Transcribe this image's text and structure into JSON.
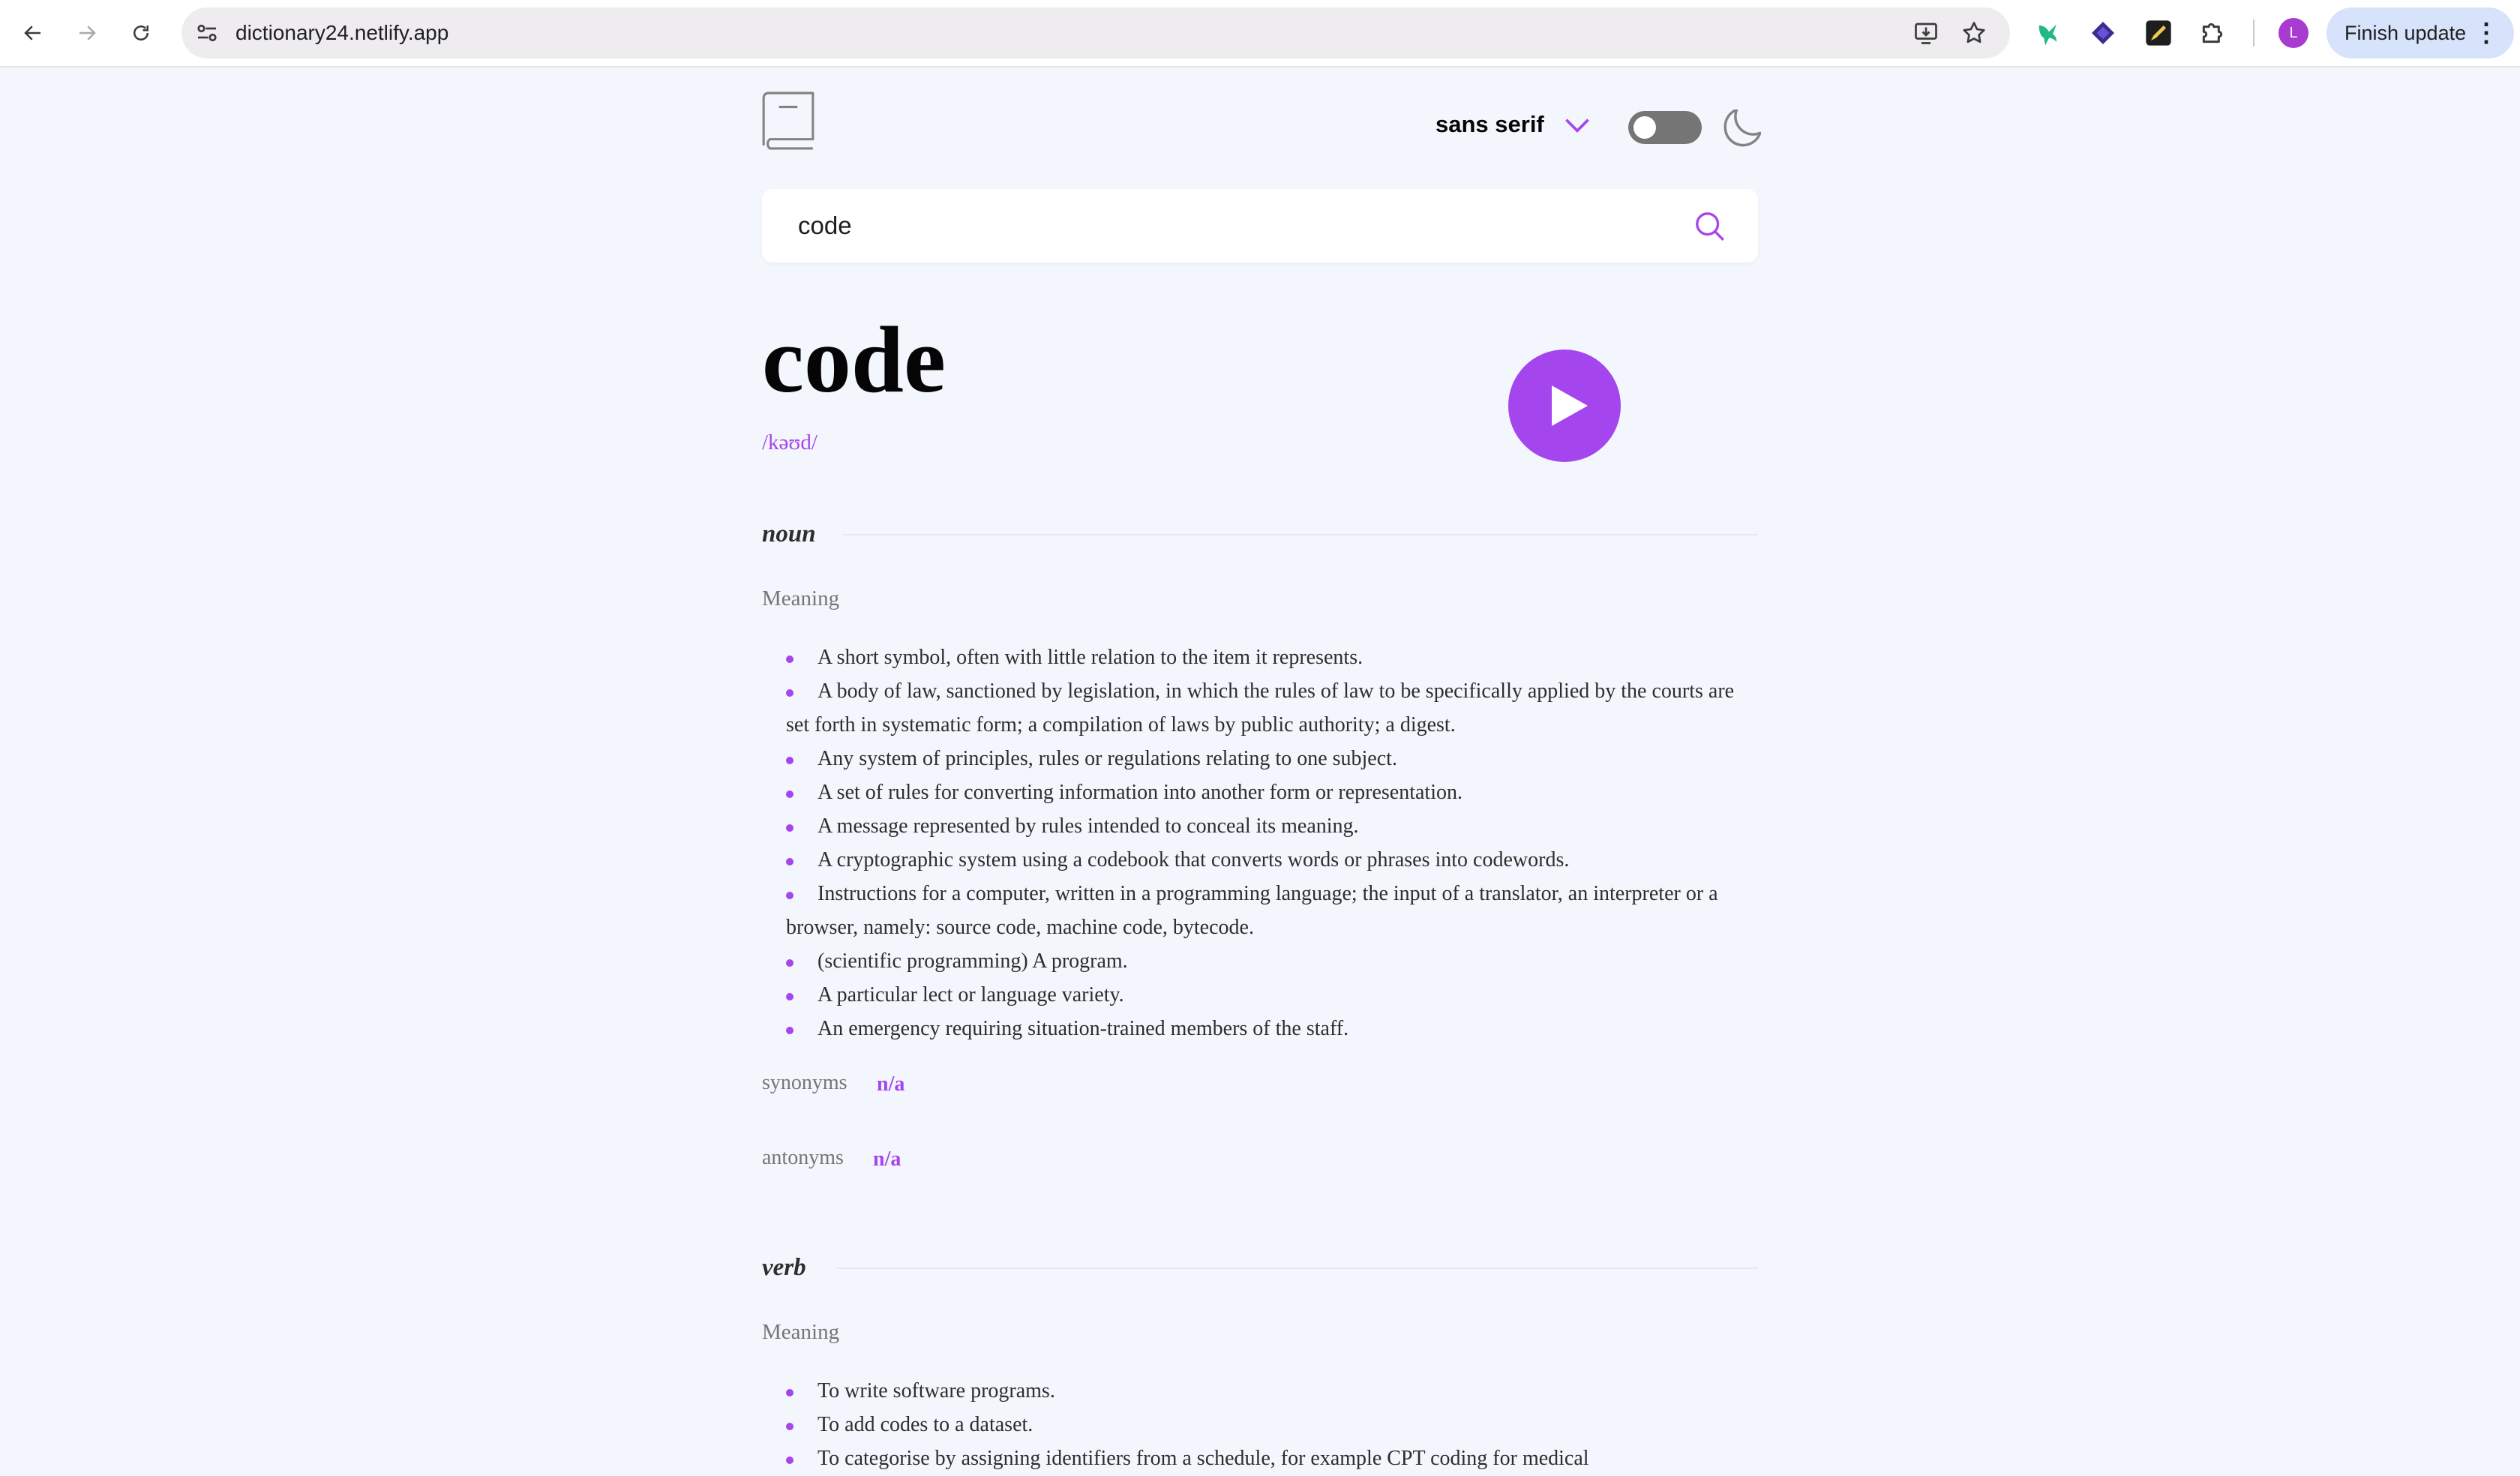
{
  "browser": {
    "url": "dictionary24.netlify.app",
    "profile_initial": "L",
    "update_label": "Finish update",
    "menu_dots": "⋮"
  },
  "app": {
    "font_label": "sans serif",
    "accent": "#a445ed",
    "search": {
      "value": "code"
    },
    "word": "code",
    "phonetic": "/kəʊd/",
    "meanings": [
      {
        "part_of_speech": "noun",
        "label": "Meaning",
        "definitions": [
          "A short symbol, often with little relation to the item it represents.",
          "A body of law, sanctioned by legislation, in which the rules of law to be specifically applied by the courts are set forth in systematic form; a compilation of laws by public authority; a digest.",
          "Any system of principles, rules or regulations relating to one subject.",
          "A set of rules for converting information into another form or representation.",
          "A message represented by rules intended to conceal its meaning.",
          "A cryptographic system using a codebook that converts words or phrases into codewords.",
          "Instructions for a computer, written in a programming language; the input of a translator, an interpreter or a browser, namely: source code, machine code, bytecode.",
          "(scientific programming) A program.",
          "A particular lect or language variety.",
          "An emergency requiring situation-trained members of the staff."
        ],
        "synonyms_label": "synonyms",
        "synonyms": "n/a",
        "antonyms_label": "antonyms",
        "antonyms": "n/a"
      },
      {
        "part_of_speech": "verb",
        "label": "Meaning",
        "definitions": [
          "To write software programs.",
          "To add codes to a dataset.",
          "To categorise by assigning identifiers from a schedule, for example CPT coding for medical"
        ]
      }
    ]
  }
}
